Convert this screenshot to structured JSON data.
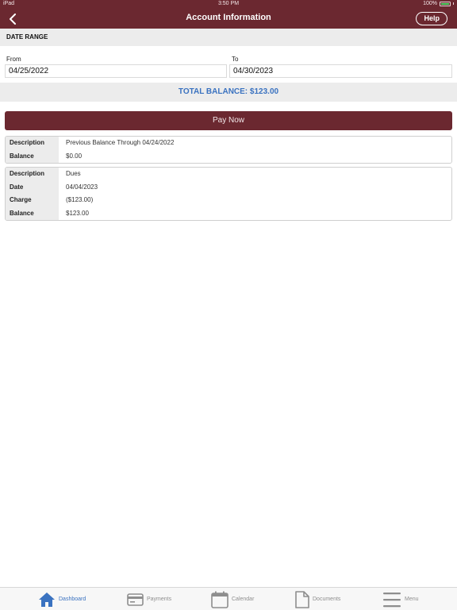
{
  "status_bar": {
    "device": "iPad",
    "time": "3:50 PM",
    "battery": "100%"
  },
  "header": {
    "title": "Account Information",
    "help_label": "Help"
  },
  "date_range": {
    "heading": "DATE RANGE",
    "from_label": "From",
    "from_value": "04/25/2022",
    "to_label": "To",
    "to_value": "04/30/2023"
  },
  "total_balance": "TOTAL BALANCE: $123.00",
  "pay_now_label": "Pay Now",
  "entries": [
    {
      "rows": [
        {
          "label": "Description",
          "value": "Previous Balance Through 04/24/2022"
        },
        {
          "label": "Balance",
          "value": "$0.00"
        }
      ]
    },
    {
      "rows": [
        {
          "label": "Description",
          "value": "Dues"
        },
        {
          "label": "Date",
          "value": "04/04/2023"
        },
        {
          "label": "Charge",
          "value": "($123.00)"
        },
        {
          "label": "Balance",
          "value": "$123.00"
        }
      ]
    }
  ],
  "tabs": [
    {
      "label": "Dashboard",
      "icon": "home-icon",
      "active": true
    },
    {
      "label": "Payments",
      "icon": "credit-card-icon",
      "active": false
    },
    {
      "label": "Calendar",
      "icon": "calendar-icon",
      "active": false
    },
    {
      "label": "Documents",
      "icon": "document-icon",
      "active": false
    },
    {
      "label": "Menu",
      "icon": "menu-icon",
      "active": false
    }
  ],
  "colors": {
    "brand": "#6b2830",
    "accent": "#3a72c0",
    "panel": "#ececec",
    "battery": "#4cd964"
  }
}
